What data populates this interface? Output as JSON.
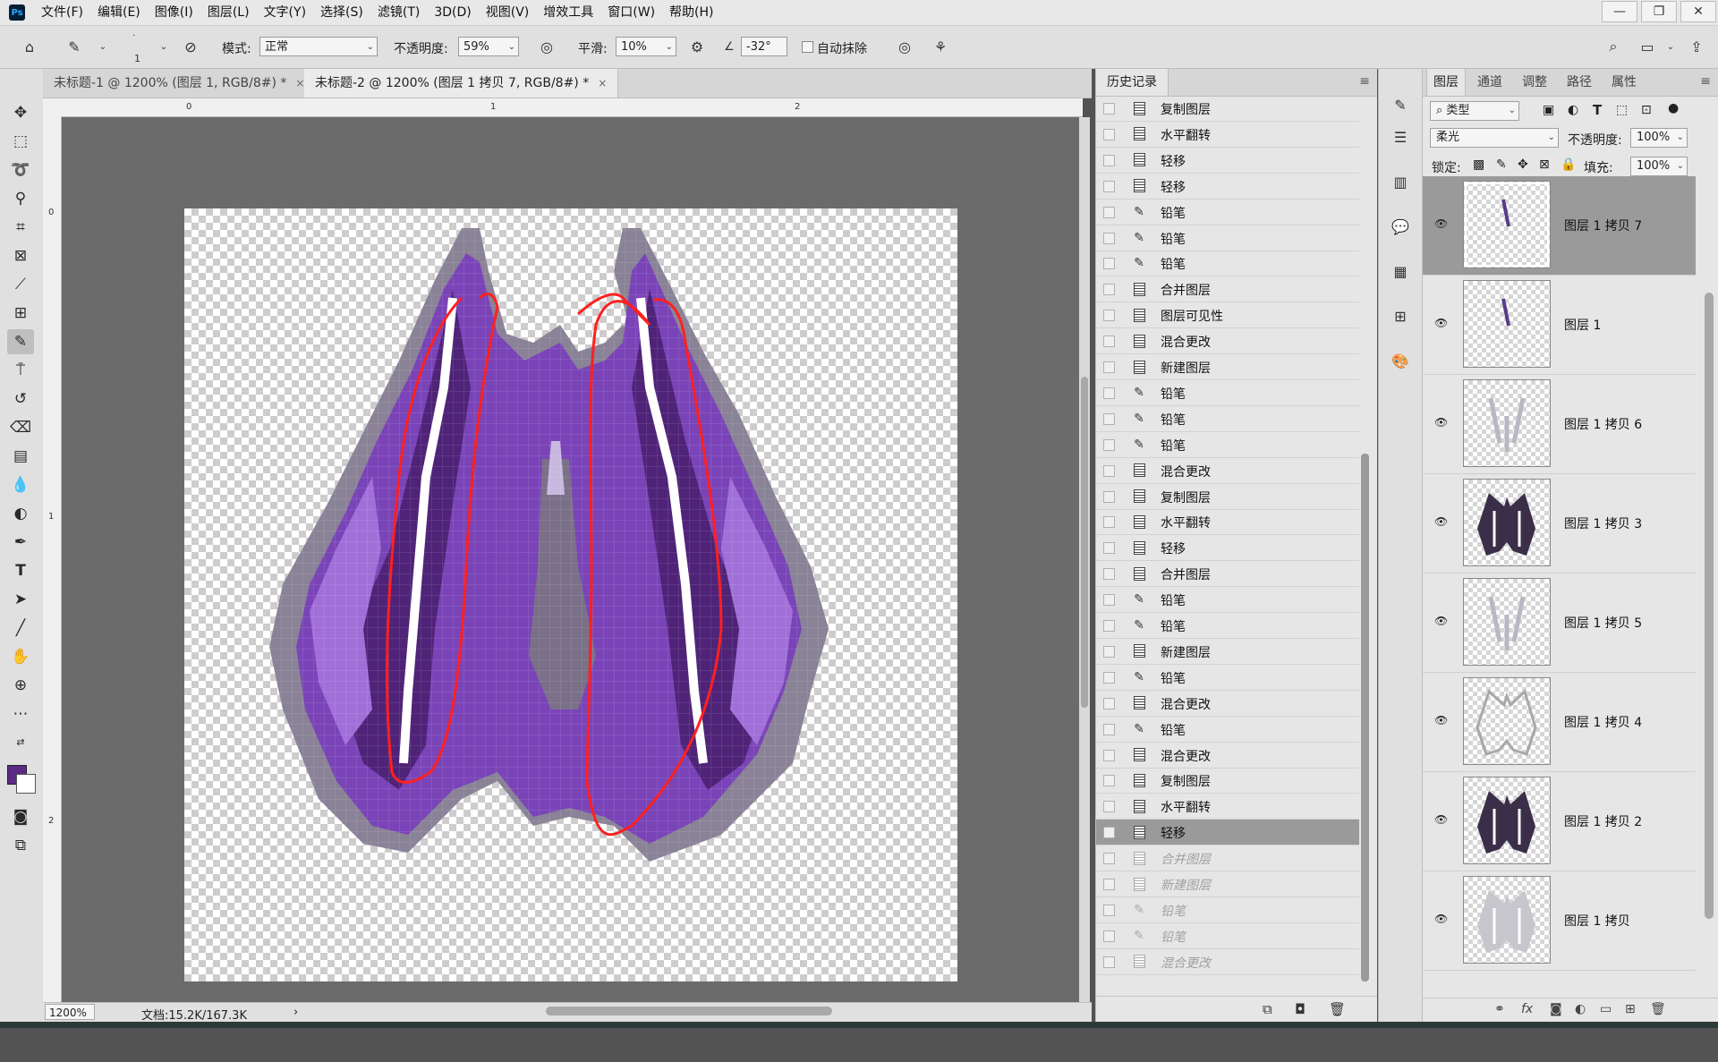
{
  "app": {
    "logo": "Ps"
  },
  "menu": [
    "文件(F)",
    "编辑(E)",
    "图像(I)",
    "图层(L)",
    "文字(Y)",
    "选择(S)",
    "滤镜(T)",
    "3D(D)",
    "视图(V)",
    "增效工具",
    "窗口(W)",
    "帮助(H)"
  ],
  "window_controls": {
    "minimize": "—",
    "restore": "❐",
    "close": "✕"
  },
  "options": {
    "brush_size": "1",
    "mode_label": "模式:",
    "mode_value": "正常",
    "opacity_label": "不透明度:",
    "opacity_value": "59%",
    "smooth_label": "平滑:",
    "smooth_value": "10%",
    "angle_value": "-32°",
    "auto_erase_label": "自动抹除"
  },
  "tabs": [
    {
      "label": "未标题-1 @ 1200% (图层 1, RGB/8#) *",
      "close": "×"
    },
    {
      "label": "未标题-2 @ 1200% (图层 1 拷贝 7, RGB/8#) *",
      "close": "×"
    }
  ],
  "ruler": {
    "h": [
      "0",
      "1",
      "2"
    ],
    "v": [
      "0",
      "1",
      "2"
    ]
  },
  "status": {
    "zoom": "1200%",
    "doc": "文档:15.2K/167.3K",
    "arrow": "›"
  },
  "colors": {
    "foreground": "#5a2a86",
    "background": "#ffffff",
    "annotation": "#ff2020",
    "purple_dark": "#4a2070",
    "purple_mid": "#7a44b8",
    "purple_light": "#a070d8"
  },
  "history": {
    "title": "历史记录",
    "items": [
      {
        "label": "复制图层",
        "icon": "doc",
        "state": "normal"
      },
      {
        "label": "水平翻转",
        "icon": "doc",
        "state": "normal"
      },
      {
        "label": "轻移",
        "icon": "doc",
        "state": "normal"
      },
      {
        "label": "轻移",
        "icon": "doc",
        "state": "normal"
      },
      {
        "label": "铅笔",
        "icon": "pencil",
        "state": "normal"
      },
      {
        "label": "铅笔",
        "icon": "pencil",
        "state": "normal"
      },
      {
        "label": "铅笔",
        "icon": "pencil",
        "state": "normal"
      },
      {
        "label": "合并图层",
        "icon": "doc",
        "state": "normal"
      },
      {
        "label": "图层可见性",
        "icon": "doc",
        "state": "normal"
      },
      {
        "label": "混合更改",
        "icon": "doc",
        "state": "normal"
      },
      {
        "label": "新建图层",
        "icon": "doc",
        "state": "normal"
      },
      {
        "label": "铅笔",
        "icon": "pencil",
        "state": "normal"
      },
      {
        "label": "铅笔",
        "icon": "pencil",
        "state": "normal"
      },
      {
        "label": "铅笔",
        "icon": "pencil",
        "state": "normal"
      },
      {
        "label": "混合更改",
        "icon": "doc",
        "state": "normal"
      },
      {
        "label": "复制图层",
        "icon": "doc",
        "state": "normal"
      },
      {
        "label": "水平翻转",
        "icon": "doc",
        "state": "normal"
      },
      {
        "label": "轻移",
        "icon": "doc",
        "state": "normal"
      },
      {
        "label": "合并图层",
        "icon": "doc",
        "state": "normal"
      },
      {
        "label": "铅笔",
        "icon": "pencil",
        "state": "normal"
      },
      {
        "label": "铅笔",
        "icon": "pencil",
        "state": "normal"
      },
      {
        "label": "新建图层",
        "icon": "doc",
        "state": "normal"
      },
      {
        "label": "铅笔",
        "icon": "pencil",
        "state": "normal"
      },
      {
        "label": "混合更改",
        "icon": "doc",
        "state": "normal"
      },
      {
        "label": "铅笔",
        "icon": "pencil",
        "state": "normal"
      },
      {
        "label": "混合更改",
        "icon": "doc",
        "state": "normal"
      },
      {
        "label": "复制图层",
        "icon": "doc",
        "state": "normal"
      },
      {
        "label": "水平翻转",
        "icon": "doc",
        "state": "normal"
      },
      {
        "label": "轻移",
        "icon": "doc",
        "state": "selected"
      },
      {
        "label": "合并图层",
        "icon": "doc",
        "state": "dim"
      },
      {
        "label": "新建图层",
        "icon": "doc",
        "state": "dim"
      },
      {
        "label": "铅笔",
        "icon": "pencil",
        "state": "dim"
      },
      {
        "label": "铅笔",
        "icon": "pencil",
        "state": "dim"
      },
      {
        "label": "混合更改",
        "icon": "doc",
        "state": "dim"
      }
    ]
  },
  "layers_panel": {
    "tabs": [
      "图层",
      "通道",
      "调整",
      "路径",
      "属性"
    ],
    "filter_value": "类型",
    "blend_value": "柔光",
    "opacity_label": "不透明度:",
    "opacity_value": "100%",
    "lock_label": "锁定:",
    "fill_label": "填充:",
    "fill_value": "100%",
    "layers": [
      {
        "name": "图层 1 拷贝 7",
        "selected": true,
        "thumb": "stroke"
      },
      {
        "name": "图层 1",
        "selected": false,
        "thumb": "stroke"
      },
      {
        "name": "图层 1 拷贝 6",
        "selected": false,
        "thumb": "faint"
      },
      {
        "name": "图层 1 拷贝 3",
        "selected": false,
        "thumb": "dark"
      },
      {
        "name": "图层 1 拷贝 5",
        "selected": false,
        "thumb": "faint"
      },
      {
        "name": "图层 1 拷贝 4",
        "selected": false,
        "thumb": "outline"
      },
      {
        "name": "图层 1 拷贝 2",
        "selected": false,
        "thumb": "dark"
      },
      {
        "name": "图层 1 拷贝",
        "selected": false,
        "thumb": "light"
      }
    ]
  }
}
